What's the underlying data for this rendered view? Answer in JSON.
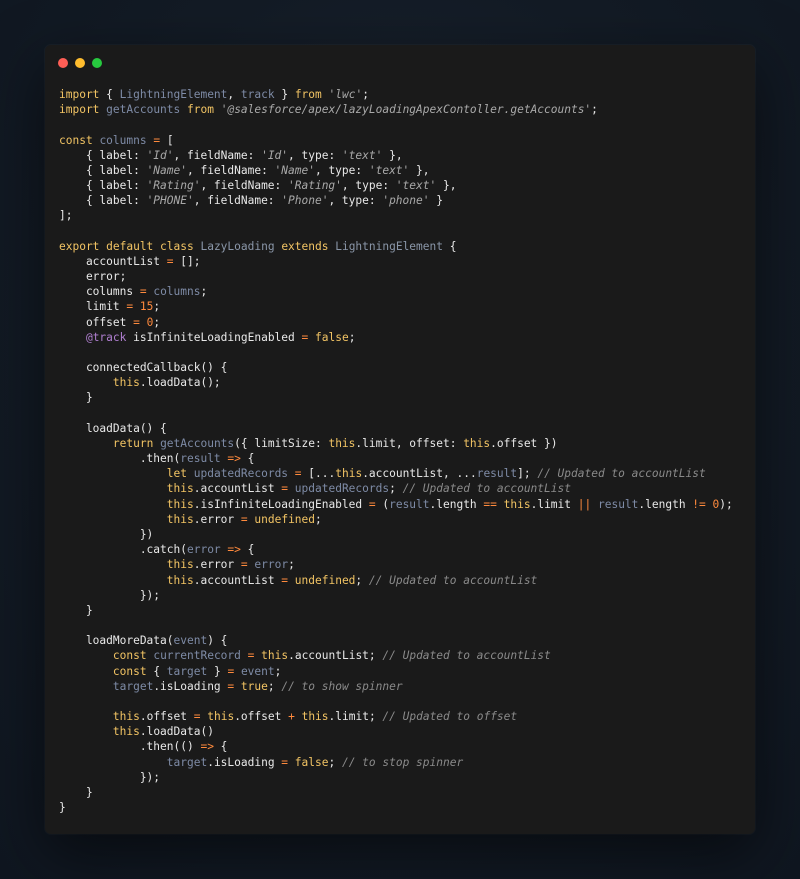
{
  "window": {
    "controls": [
      "close",
      "minimize",
      "maximize"
    ],
    "colors": {
      "close": "#ff5f56",
      "minimize": "#ffbd2e",
      "maximize": "#27c93f"
    }
  },
  "code": {
    "language": "javascript",
    "lines": [
      [
        [
          "kw",
          "import"
        ],
        [
          "plain",
          " { "
        ],
        [
          "var",
          "LightningElement"
        ],
        [
          "plain",
          ", "
        ],
        [
          "var",
          "track"
        ],
        [
          "plain",
          " } "
        ],
        [
          "kw",
          "from"
        ],
        [
          "plain",
          " "
        ],
        [
          "str",
          "'lwc'"
        ],
        [
          "plain",
          ";"
        ]
      ],
      [
        [
          "kw",
          "import"
        ],
        [
          "plain",
          " "
        ],
        [
          "var",
          "getAccounts"
        ],
        [
          "plain",
          " "
        ],
        [
          "kw",
          "from"
        ],
        [
          "plain",
          " "
        ],
        [
          "str",
          "'@salesforce/apex/lazyLoadingApexContoller.getAccounts'"
        ],
        [
          "plain",
          ";"
        ]
      ],
      [],
      [
        [
          "kw",
          "const"
        ],
        [
          "plain",
          " "
        ],
        [
          "var",
          "columns"
        ],
        [
          "plain",
          " "
        ],
        [
          "op",
          "="
        ],
        [
          "plain",
          " ["
        ]
      ],
      [
        [
          "plain",
          "    { label: "
        ],
        [
          "str",
          "'Id'"
        ],
        [
          "plain",
          ", fieldName: "
        ],
        [
          "str",
          "'Id'"
        ],
        [
          "plain",
          ", type: "
        ],
        [
          "str",
          "'text'"
        ],
        [
          "plain",
          " },"
        ]
      ],
      [
        [
          "plain",
          "    { label: "
        ],
        [
          "str",
          "'Name'"
        ],
        [
          "plain",
          ", fieldName: "
        ],
        [
          "str",
          "'Name'"
        ],
        [
          "plain",
          ", type: "
        ],
        [
          "str",
          "'text'"
        ],
        [
          "plain",
          " },"
        ]
      ],
      [
        [
          "plain",
          "    { label: "
        ],
        [
          "str",
          "'Rating'"
        ],
        [
          "plain",
          ", fieldName: "
        ],
        [
          "str",
          "'Rating'"
        ],
        [
          "plain",
          ", type: "
        ],
        [
          "str",
          "'text'"
        ],
        [
          "plain",
          " },"
        ]
      ],
      [
        [
          "plain",
          "    { label: "
        ],
        [
          "str",
          "'PHONE'"
        ],
        [
          "plain",
          ", fieldName: "
        ],
        [
          "str",
          "'Phone'"
        ],
        [
          "plain",
          ", type: "
        ],
        [
          "str",
          "'phone'"
        ],
        [
          "plain",
          " }"
        ]
      ],
      [
        [
          "plain",
          "];"
        ]
      ],
      [],
      [
        [
          "kw",
          "export default class"
        ],
        [
          "plain",
          " "
        ],
        [
          "cls",
          "LazyLoading"
        ],
        [
          "plain",
          " "
        ],
        [
          "kw",
          "extends"
        ],
        [
          "plain",
          " "
        ],
        [
          "cls",
          "LightningElement"
        ],
        [
          "plain",
          " {"
        ]
      ],
      [
        [
          "plain",
          "    accountList "
        ],
        [
          "op",
          "="
        ],
        [
          "plain",
          " [];"
        ]
      ],
      [
        [
          "plain",
          "    error;"
        ]
      ],
      [
        [
          "plain",
          "    columns "
        ],
        [
          "op",
          "="
        ],
        [
          "plain",
          " "
        ],
        [
          "var",
          "columns"
        ],
        [
          "plain",
          ";"
        ]
      ],
      [
        [
          "plain",
          "    limit "
        ],
        [
          "op",
          "="
        ],
        [
          "plain",
          " "
        ],
        [
          "num",
          "15"
        ],
        [
          "plain",
          ";"
        ]
      ],
      [
        [
          "plain",
          "    offset "
        ],
        [
          "op",
          "="
        ],
        [
          "plain",
          " "
        ],
        [
          "num",
          "0"
        ],
        [
          "plain",
          ";"
        ]
      ],
      [
        [
          "plain",
          "    "
        ],
        [
          "dec",
          "@track"
        ],
        [
          "plain",
          " isInfiniteLoadingEnabled "
        ],
        [
          "op",
          "="
        ],
        [
          "plain",
          " "
        ],
        [
          "kw",
          "false"
        ],
        [
          "plain",
          ";"
        ]
      ],
      [],
      [
        [
          "plain",
          "    connectedCallback() {"
        ]
      ],
      [
        [
          "plain",
          "        "
        ],
        [
          "kw",
          "this"
        ],
        [
          "plain",
          ".loadData();"
        ]
      ],
      [
        [
          "plain",
          "    }"
        ]
      ],
      [],
      [
        [
          "plain",
          "    loadData() {"
        ]
      ],
      [
        [
          "plain",
          "        "
        ],
        [
          "kw",
          "return"
        ],
        [
          "plain",
          " "
        ],
        [
          "var",
          "getAccounts"
        ],
        [
          "plain",
          "({ limitSize: "
        ],
        [
          "kw",
          "this"
        ],
        [
          "plain",
          ".limit, offset: "
        ],
        [
          "kw",
          "this"
        ],
        [
          "plain",
          ".offset })"
        ]
      ],
      [
        [
          "plain",
          "            .then("
        ],
        [
          "var",
          "result"
        ],
        [
          "plain",
          " "
        ],
        [
          "op",
          "=>"
        ],
        [
          "plain",
          " {"
        ]
      ],
      [
        [
          "plain",
          "                "
        ],
        [
          "kw",
          "let"
        ],
        [
          "plain",
          " "
        ],
        [
          "var",
          "updatedRecords"
        ],
        [
          "plain",
          " "
        ],
        [
          "op",
          "="
        ],
        [
          "plain",
          " [..."
        ],
        [
          "kw",
          "this"
        ],
        [
          "plain",
          ".accountList, ..."
        ],
        [
          "var",
          "result"
        ],
        [
          "plain",
          "]; "
        ],
        [
          "cm",
          "// Updated to accountList"
        ]
      ],
      [
        [
          "plain",
          "                "
        ],
        [
          "kw",
          "this"
        ],
        [
          "plain",
          ".accountList "
        ],
        [
          "op",
          "="
        ],
        [
          "plain",
          " "
        ],
        [
          "var",
          "updatedRecords"
        ],
        [
          "plain",
          "; "
        ],
        [
          "cm",
          "// Updated to accountList"
        ]
      ],
      [
        [
          "plain",
          "                "
        ],
        [
          "kw",
          "this"
        ],
        [
          "plain",
          ".isInfiniteLoadingEnabled "
        ],
        [
          "op",
          "="
        ],
        [
          "plain",
          " ("
        ],
        [
          "var",
          "result"
        ],
        [
          "plain",
          ".length "
        ],
        [
          "op",
          "=="
        ],
        [
          "plain",
          " "
        ],
        [
          "kw",
          "this"
        ],
        [
          "plain",
          ".limit "
        ],
        [
          "op",
          "||"
        ],
        [
          "plain",
          " "
        ],
        [
          "var",
          "result"
        ],
        [
          "plain",
          ".length "
        ],
        [
          "op",
          "!="
        ],
        [
          "plain",
          " "
        ],
        [
          "num",
          "0"
        ],
        [
          "plain",
          ");"
        ]
      ],
      [
        [
          "plain",
          "                "
        ],
        [
          "kw",
          "this"
        ],
        [
          "plain",
          ".error "
        ],
        [
          "op",
          "="
        ],
        [
          "plain",
          " "
        ],
        [
          "kw",
          "undefined"
        ],
        [
          "plain",
          ";"
        ]
      ],
      [
        [
          "plain",
          "            })"
        ]
      ],
      [
        [
          "plain",
          "            .catch("
        ],
        [
          "var",
          "error"
        ],
        [
          "plain",
          " "
        ],
        [
          "op",
          "=>"
        ],
        [
          "plain",
          " {"
        ]
      ],
      [
        [
          "plain",
          "                "
        ],
        [
          "kw",
          "this"
        ],
        [
          "plain",
          ".error "
        ],
        [
          "op",
          "="
        ],
        [
          "plain",
          " "
        ],
        [
          "var",
          "error"
        ],
        [
          "plain",
          ";"
        ]
      ],
      [
        [
          "plain",
          "                "
        ],
        [
          "kw",
          "this"
        ],
        [
          "plain",
          ".accountList "
        ],
        [
          "op",
          "="
        ],
        [
          "plain",
          " "
        ],
        [
          "kw",
          "undefined"
        ],
        [
          "plain",
          "; "
        ],
        [
          "cm",
          "// Updated to accountList"
        ]
      ],
      [
        [
          "plain",
          "            });"
        ]
      ],
      [
        [
          "plain",
          "    }"
        ]
      ],
      [],
      [
        [
          "plain",
          "    loadMoreData("
        ],
        [
          "var",
          "event"
        ],
        [
          "plain",
          ") {"
        ]
      ],
      [
        [
          "plain",
          "        "
        ],
        [
          "kw",
          "const"
        ],
        [
          "plain",
          " "
        ],
        [
          "var",
          "currentRecord"
        ],
        [
          "plain",
          " "
        ],
        [
          "op",
          "="
        ],
        [
          "plain",
          " "
        ],
        [
          "kw",
          "this"
        ],
        [
          "plain",
          ".accountList; "
        ],
        [
          "cm",
          "// Updated to accountList"
        ]
      ],
      [
        [
          "plain",
          "        "
        ],
        [
          "kw",
          "const"
        ],
        [
          "plain",
          " { "
        ],
        [
          "var",
          "target"
        ],
        [
          "plain",
          " } "
        ],
        [
          "op",
          "="
        ],
        [
          "plain",
          " "
        ],
        [
          "var",
          "event"
        ],
        [
          "plain",
          ";"
        ]
      ],
      [
        [
          "plain",
          "        "
        ],
        [
          "var",
          "target"
        ],
        [
          "plain",
          ".isLoading "
        ],
        [
          "op",
          "="
        ],
        [
          "plain",
          " "
        ],
        [
          "kw",
          "true"
        ],
        [
          "plain",
          "; "
        ],
        [
          "cm",
          "// to show spinner"
        ]
      ],
      [],
      [
        [
          "plain",
          "        "
        ],
        [
          "kw",
          "this"
        ],
        [
          "plain",
          ".offset "
        ],
        [
          "op",
          "="
        ],
        [
          "plain",
          " "
        ],
        [
          "kw",
          "this"
        ],
        [
          "plain",
          ".offset "
        ],
        [
          "op",
          "+"
        ],
        [
          "plain",
          " "
        ],
        [
          "kw",
          "this"
        ],
        [
          "plain",
          ".limit; "
        ],
        [
          "cm",
          "// Updated to offset"
        ]
      ],
      [
        [
          "plain",
          "        "
        ],
        [
          "kw",
          "this"
        ],
        [
          "plain",
          ".loadData()"
        ]
      ],
      [
        [
          "plain",
          "            .then(() "
        ],
        [
          "op",
          "=>"
        ],
        [
          "plain",
          " {"
        ]
      ],
      [
        [
          "plain",
          "                "
        ],
        [
          "var",
          "target"
        ],
        [
          "plain",
          ".isLoading "
        ],
        [
          "op",
          "="
        ],
        [
          "plain",
          " "
        ],
        [
          "kw",
          "false"
        ],
        [
          "plain",
          "; "
        ],
        [
          "cm",
          "// to stop spinner"
        ]
      ],
      [
        [
          "plain",
          "            });"
        ]
      ],
      [
        [
          "plain",
          "    }"
        ]
      ],
      [
        [
          "plain",
          "}"
        ]
      ]
    ]
  }
}
